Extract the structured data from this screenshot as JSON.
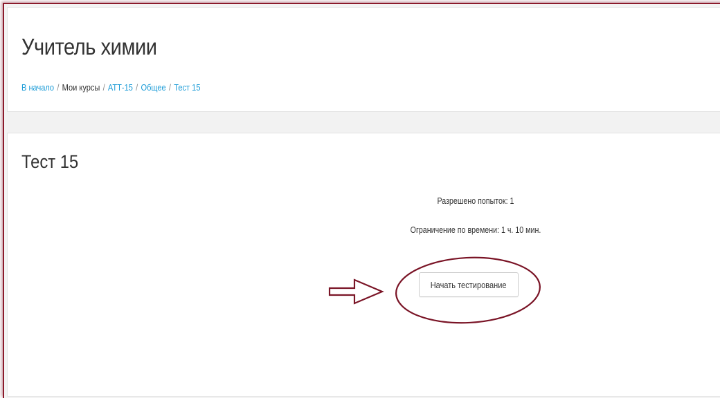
{
  "page": {
    "title": "Учитель химии"
  },
  "breadcrumb": {
    "items": [
      {
        "label": "В начало",
        "link": true
      },
      {
        "label": "Мои курсы",
        "link": false
      },
      {
        "label": "АТТ-15",
        "link": true
      },
      {
        "label": "Общее",
        "link": true
      },
      {
        "label": "Тест 15",
        "link": true
      }
    ],
    "separator": "/"
  },
  "quiz": {
    "title": "Тест 15",
    "attempts_allowed": "Разрешено попыток: 1",
    "time_limit": "Ограничение по времени: 1 ч. 10 мин.",
    "start_button_label": "Начать тестирование"
  },
  "colors": {
    "link": "#1a9bd7",
    "annotation": "#7a1426",
    "text": "#333333"
  }
}
